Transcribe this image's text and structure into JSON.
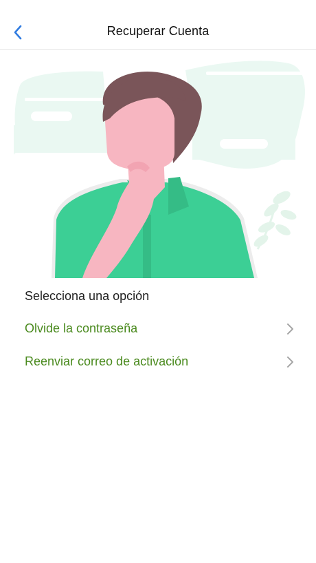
{
  "navbar": {
    "title": "Recuperar Cuenta",
    "back_icon": "chevron-left-icon"
  },
  "illustration": {
    "subject": "thinking-man-illustration"
  },
  "content": {
    "heading": "Selecciona una opción",
    "options": [
      {
        "label": "Olvide la contraseña",
        "icon": "chevron-right-icon"
      },
      {
        "label": "Reenviar correo de activación",
        "icon": "chevron-right-icon"
      }
    ]
  },
  "colors": {
    "accent_blue": "#2f7be0",
    "option_green": "#4a8a1e",
    "shirt_green": "#3ccf95",
    "skin_pink": "#f7b6c1",
    "hair_brown": "#7a5559",
    "bg_mint": "#eaf8f2"
  }
}
